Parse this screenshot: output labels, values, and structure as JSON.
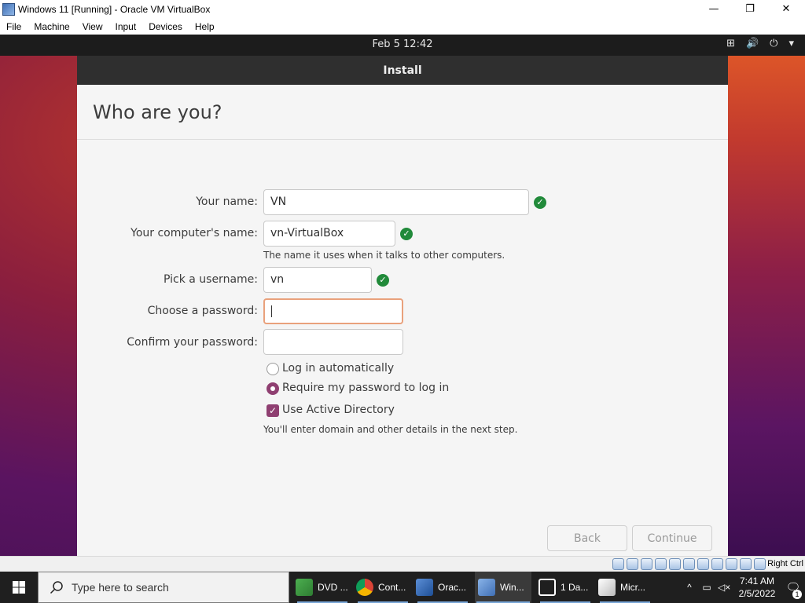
{
  "window": {
    "title": "Windows 11 [Running] - Oracle VM VirtualBox",
    "minimize": "—",
    "maximize": "❐",
    "close": "✕"
  },
  "menu": [
    "File",
    "Machine",
    "View",
    "Input",
    "Devices",
    "Help"
  ],
  "vm_topbar": {
    "clock": "Feb 5  12:42",
    "network_icon": "⊞",
    "volume_icon": "🔊",
    "power_icon": "⏻",
    "menu_arrow": "▾"
  },
  "installer": {
    "header": "Install",
    "heading": "Who are you?",
    "your_name_label": "Your name:",
    "your_name_value": "VN",
    "computer_name_label": "Your computer's name:",
    "computer_name_value": "vn-VirtualBox",
    "computer_name_hint": "The name it uses when it talks to other computers.",
    "username_label": "Pick a username:",
    "username_value": "vn",
    "password_label": "Choose a password:",
    "password_value": "",
    "confirm_label": "Confirm your password:",
    "confirm_value": "",
    "login_auto": "Log in automatically",
    "login_require": "Require my password to log in",
    "use_ad": "Use Active Directory",
    "ad_hint": "You'll enter domain and other details in the next step.",
    "back": "Back",
    "continue": "Continue",
    "check_glyph": "✓",
    "checkbox_glyph": "✓"
  },
  "statusbar": {
    "host_key": "Right Ctrl"
  },
  "taskbar": {
    "search_placeholder": "Type here to search",
    "items": [
      {
        "label": "DVD ..."
      },
      {
        "label": "Cont..."
      },
      {
        "label": "Orac..."
      },
      {
        "label": "Win..."
      },
      {
        "label": "1 Da..."
      },
      {
        "label": "Micr..."
      }
    ],
    "tray_chevron": "^",
    "time": "7:41 AM",
    "date": "2/5/2022",
    "notification_count": "1",
    "notification_icon": "🗨"
  },
  "colors": {
    "accent_purple": "#8f3f71",
    "check_green": "#218a3a",
    "focus_orange": "#e9a17c"
  }
}
